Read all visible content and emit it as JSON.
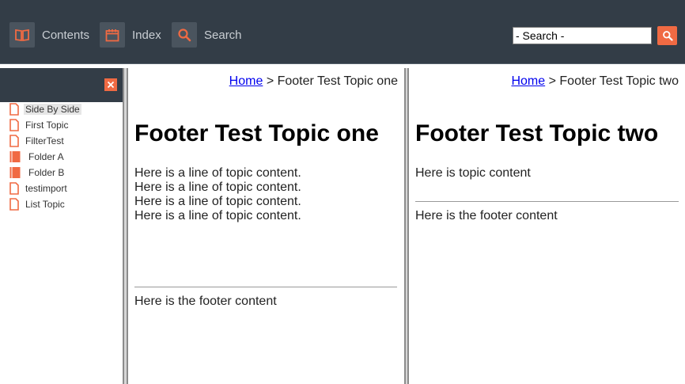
{
  "toolbar": {
    "contents_label": "Contents",
    "index_label": "Index",
    "search_label": "Search",
    "search_placeholder": "- Search -",
    "accent_color": "#f06a43",
    "icons": {
      "contents": "book-icon",
      "index": "calendar-icon",
      "search": "magnifier-icon",
      "search_go": "magnifier-icon"
    }
  },
  "sidebar": {
    "close_icon": "close-icon",
    "items": [
      {
        "label": "Side By Side",
        "icon": "page-icon",
        "selected": true
      },
      {
        "label": "First Topic",
        "icon": "page-icon"
      },
      {
        "label": "FilterTest",
        "icon": "page-icon"
      },
      {
        "label": "Folder A",
        "icon": "folder-book-icon"
      },
      {
        "label": "Folder B",
        "icon": "folder-book-icon"
      },
      {
        "label": "testimport",
        "icon": "page-icon"
      },
      {
        "label": "List Topic",
        "icon": "page-icon"
      }
    ]
  },
  "pane_one": {
    "breadcrumb_home": "Home",
    "breadcrumb_sep": ">",
    "breadcrumb_current": "Footer Test Topic one",
    "title": "Footer Test Topic one",
    "lines": [
      "Here is a line of topic content.",
      "Here is a line of topic content.",
      "Here is a line of topic content.",
      "Here is a line of topic content."
    ],
    "footer": "Here is the footer content"
  },
  "pane_two": {
    "breadcrumb_home": "Home",
    "breadcrumb_sep": ">",
    "breadcrumb_current": "Footer Test Topic two",
    "title": "Footer Test Topic two",
    "lines": [
      "Here is topic content"
    ],
    "footer": "Here is the footer content"
  }
}
